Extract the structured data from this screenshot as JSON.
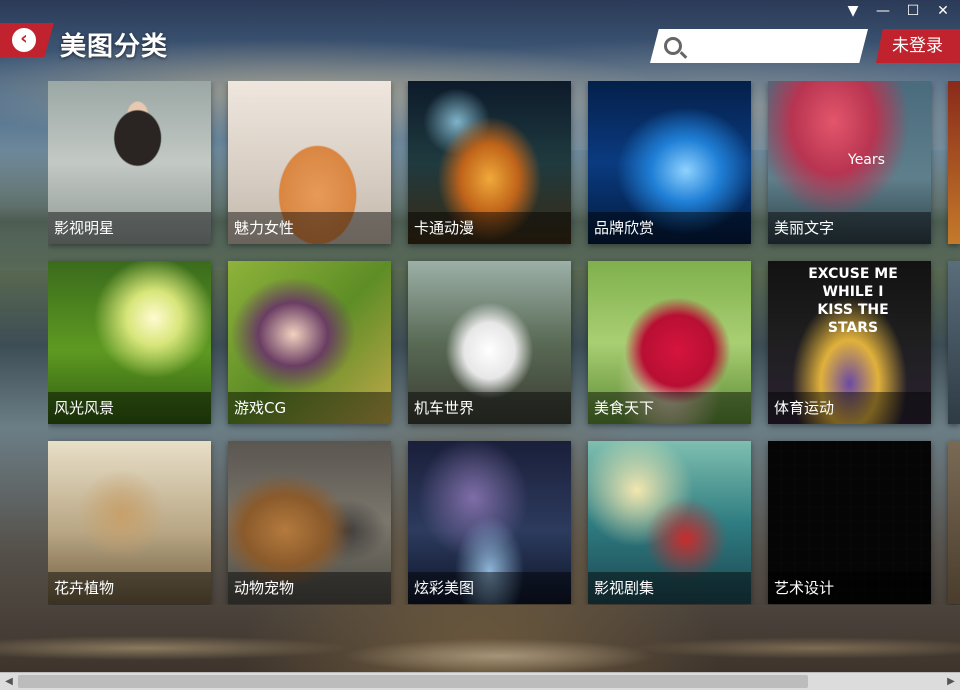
{
  "header": {
    "title": "美图分类",
    "back_icon": "chevron-left-icon",
    "search_placeholder": "",
    "search_value": "",
    "login_label": "未登录"
  },
  "window_controls": {
    "menu_glyph": "▼",
    "minimize_glyph": "—",
    "maximize_glyph": "☐",
    "close_glyph": "✕"
  },
  "categories": [
    {
      "label": "影视明星"
    },
    {
      "label": "魅力女性"
    },
    {
      "label": "卡通动漫"
    },
    {
      "label": "品牌欣赏"
    },
    {
      "label": "美丽文字",
      "overlay_text": "Years"
    },
    {
      "label": "风光风景"
    },
    {
      "label": "游戏CG"
    },
    {
      "label": "机车世界"
    },
    {
      "label": "美食天下"
    },
    {
      "label": "体育运动",
      "overlay_text": "EXCUSE ME WHILE I KISS THE STARS"
    },
    {
      "label": "花卉植物"
    },
    {
      "label": "动物宠物"
    },
    {
      "label": "炫彩美图"
    },
    {
      "label": "影视剧集"
    },
    {
      "label": "艺术设计"
    }
  ],
  "colors": {
    "accent_red": "#c0232e",
    "label_overlay": "rgba(0,0,0,0.45)"
  }
}
